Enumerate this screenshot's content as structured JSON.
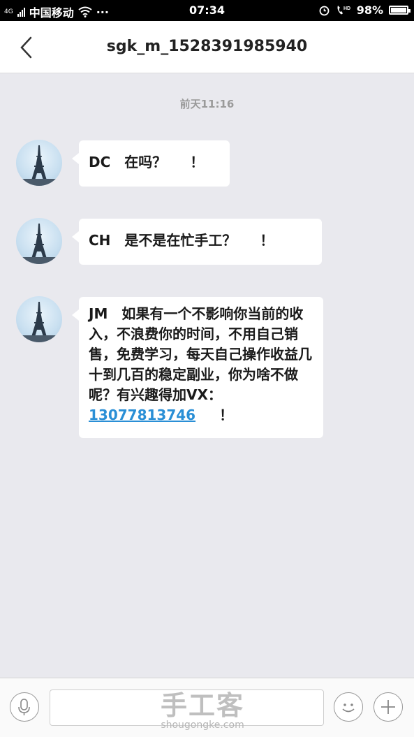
{
  "status_bar": {
    "network_type": "4G",
    "carrier": "中国移动",
    "more": "···",
    "time": "07:34",
    "battery": "98%",
    "battery_level": 0.98,
    "icons": [
      "signal-icon",
      "wifi-icon",
      "alarm-icon",
      "hd-call-icon",
      "battery-icon"
    ]
  },
  "header": {
    "title": "sgk_m_1528391985940",
    "back_icon": "chevron-left-icon"
  },
  "chat": {
    "timestamp": "前天11:16",
    "messages": [
      {
        "text": "DC　在吗？",
        "tail": "！"
      },
      {
        "text": "CH　是不是在忙手工？",
        "tail": "！"
      },
      {
        "text": "JM　如果有一个不影响你当前的收入，不浪费你的时间，不用自己销售，免费学习，每天自己操作收益几十到几百的稳定副业，你为啥不做呢？有兴趣得加VX：",
        "link": "13077813746",
        "tail": "！"
      }
    ]
  },
  "input_bar": {
    "placeholder": "",
    "icons": [
      "microphone-icon",
      "smiley-icon",
      "plus-icon"
    ]
  },
  "watermark": {
    "brand": "手工客",
    "url": "shougongke.com"
  }
}
